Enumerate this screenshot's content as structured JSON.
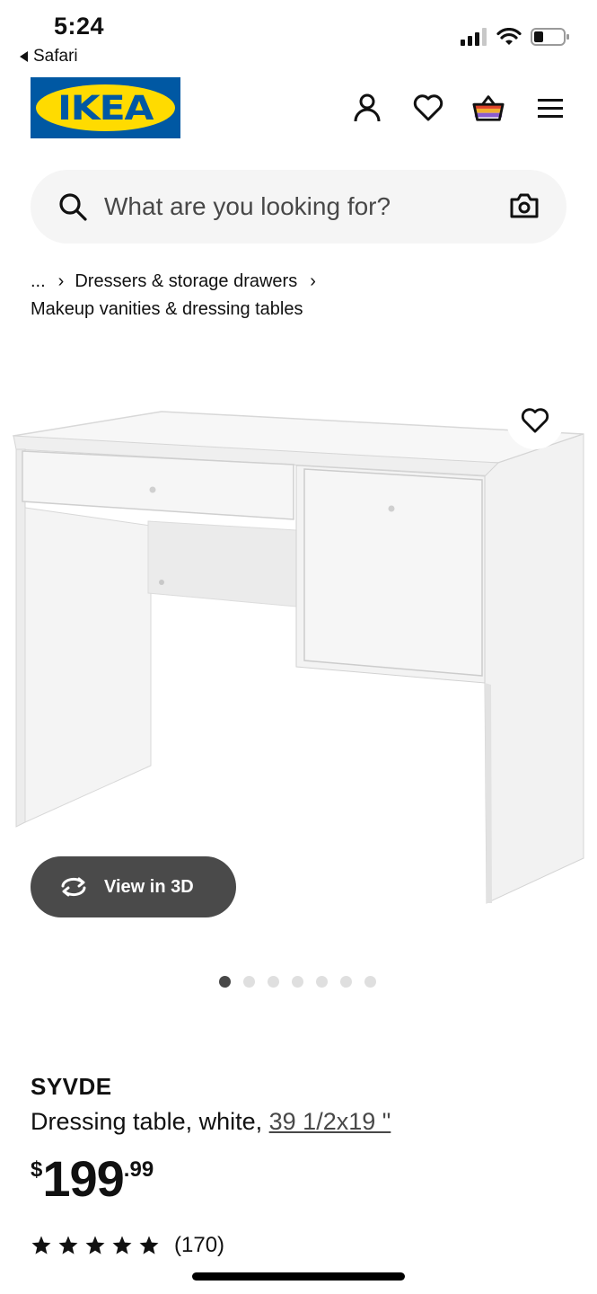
{
  "status_bar": {
    "time": "5:24",
    "back_app": "Safari"
  },
  "header": {
    "logo_text": "IKEA",
    "icons": [
      "account-icon",
      "wishlist-icon",
      "basket-icon",
      "menu-icon"
    ],
    "brand_colors": {
      "blue": "#0058a3",
      "yellow": "#ffdb00"
    }
  },
  "search": {
    "placeholder": "What are you looking for?"
  },
  "breadcrumb": {
    "ellipsis": "...",
    "item1": "Dressers & storage drawers",
    "item2": "Makeup vanities & dressing tables"
  },
  "gallery": {
    "view_3d_label": "View in 3D",
    "image_count": 7,
    "active_index": 0
  },
  "product": {
    "name": "SYVDE",
    "description": "Dressing table, white,",
    "size_link": "39 1/2x19 \"",
    "price_currency": "$",
    "price_int": "199",
    "price_dec": ".99",
    "rating_stars": 5,
    "rating_count": "(170)"
  }
}
